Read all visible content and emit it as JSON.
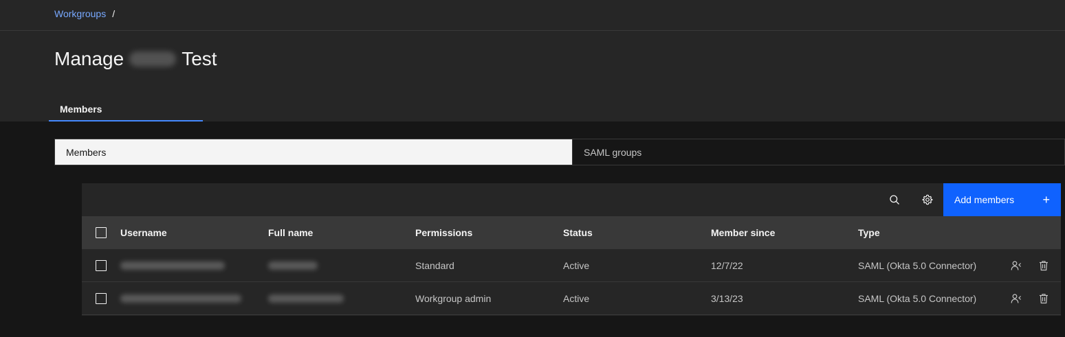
{
  "breadcrumb": {
    "link": "Workgroups",
    "separator": "/"
  },
  "page": {
    "title_prefix": "Manage",
    "title_suffix": "Test"
  },
  "tabs": [
    {
      "label": "Members",
      "active": true
    }
  ],
  "switcher": {
    "options": [
      {
        "label": "Members",
        "selected": true
      },
      {
        "label": "SAML groups",
        "selected": false
      }
    ]
  },
  "toolbar": {
    "icons": [
      "search-icon",
      "settings-icon"
    ],
    "add_button_label": "Add members",
    "add_button_icon": "+"
  },
  "table": {
    "columns": [
      "Username",
      "Full name",
      "Permissions",
      "Status",
      "Member since",
      "Type"
    ],
    "rows": [
      {
        "permissions": "Standard",
        "status": "Active",
        "member_since": "12/7/22",
        "type": "SAML (Okta 5.0 Connector)"
      },
      {
        "permissions": "Workgroup admin",
        "status": "Active",
        "member_since": "3/13/23",
        "type": "SAML (Okta 5.0 Connector)"
      }
    ],
    "row_action_icons": [
      "user-role-icon",
      "trash-icon"
    ]
  },
  "colors": {
    "background": "#161616",
    "header_background": "#262626",
    "accent_blue": "#0f62fe",
    "link_blue": "#78a9ff",
    "tab_underline": "#4589ff"
  }
}
